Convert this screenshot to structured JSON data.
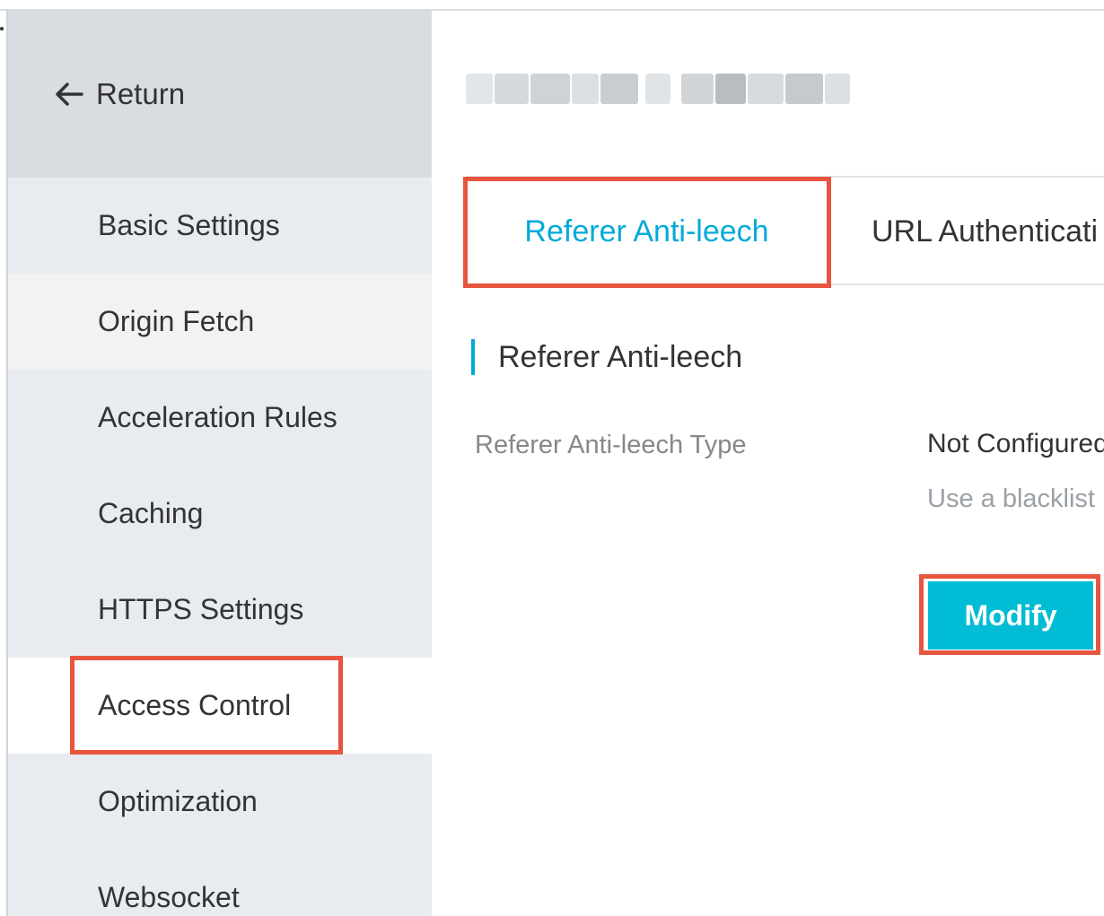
{
  "sidebar": {
    "return_label": "Return",
    "items": [
      {
        "label": "Basic Settings"
      },
      {
        "label": "Origin Fetch"
      },
      {
        "label": "Acceleration Rules"
      },
      {
        "label": "Caching"
      },
      {
        "label": "HTTPS Settings"
      },
      {
        "label": "Access Control"
      },
      {
        "label": "Optimization"
      },
      {
        "label": "Websocket"
      }
    ],
    "active_item": "Access Control",
    "hovered_item": "Origin Fetch"
  },
  "tabs": [
    {
      "label": "Referer Anti-leech",
      "active": true
    },
    {
      "label": "URL Authenticati",
      "active": false
    }
  ],
  "section": {
    "title": "Referer Anti-leech"
  },
  "field": {
    "label": "Referer Anti-leech Type",
    "value": "Not Configured",
    "description": "Use a blacklist"
  },
  "modify_label": "Modify",
  "colors": {
    "accent": "#00aad8",
    "button": "#00bcd4",
    "highlight": "#e8553e",
    "sidebar_bg": "#e8ecf0"
  },
  "icons": {
    "return": "arrow-left-icon"
  }
}
